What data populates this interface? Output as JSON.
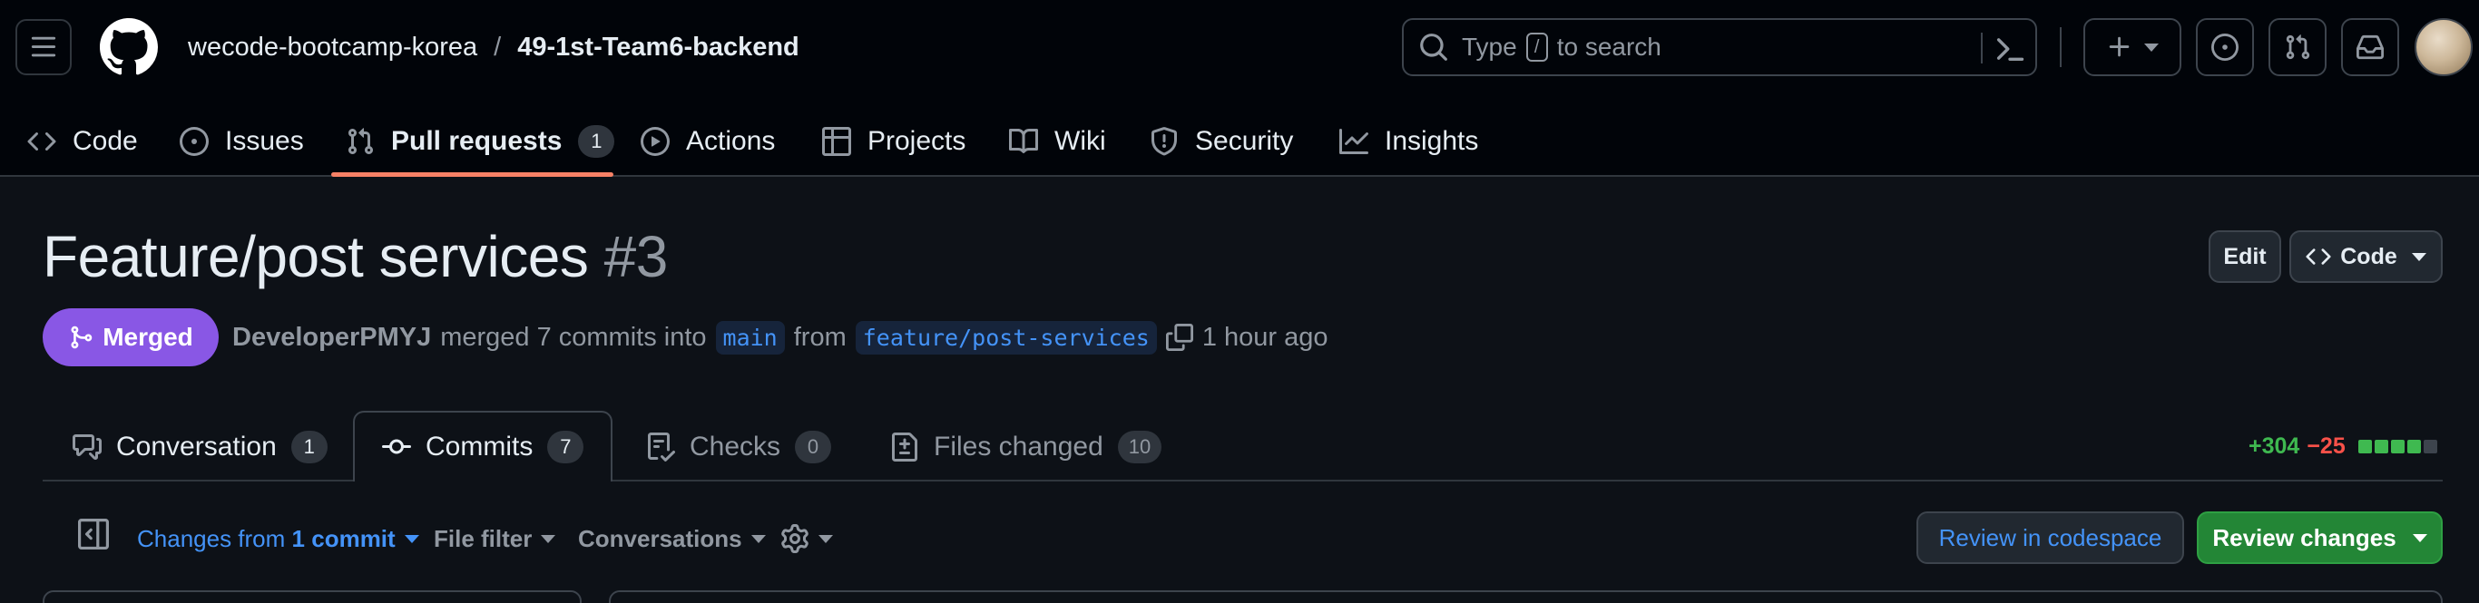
{
  "header": {
    "repo_owner": "wecode-bootcamp-korea",
    "repo_separator": "/",
    "repo_name": "49-1st-Team6-backend",
    "search": {
      "before": "Type",
      "key": "/",
      "after": "to search"
    }
  },
  "repo_nav": [
    {
      "label": "Code",
      "icon": "code-icon"
    },
    {
      "label": "Issues",
      "icon": "issue-icon"
    },
    {
      "label": "Pull requests",
      "icon": "pull-request-icon",
      "count": "1",
      "active": true
    },
    {
      "label": "Actions",
      "icon": "play-icon"
    },
    {
      "label": "Projects",
      "icon": "table-icon"
    },
    {
      "label": "Wiki",
      "icon": "book-icon"
    },
    {
      "label": "Security",
      "icon": "shield-icon"
    },
    {
      "label": "Insights",
      "icon": "graph-icon"
    }
  ],
  "pr": {
    "title": "Feature/post services",
    "number": "#3",
    "state": "Merged",
    "author": "DeveloperPMYJ",
    "action_text": "merged 7 commits into",
    "base_branch": "main",
    "from_text": "from",
    "head_branch": "feature/post-services",
    "time": "1 hour ago",
    "edit_label": "Edit",
    "code_label": "Code"
  },
  "tabs": [
    {
      "label": "Conversation",
      "count": "1",
      "icon": "comment-icon"
    },
    {
      "label": "Commits",
      "count": "7",
      "icon": "commit-icon",
      "active": true
    },
    {
      "label": "Checks",
      "count": "0",
      "icon": "checklist-icon"
    },
    {
      "label": "Files changed",
      "count": "10",
      "icon": "file-diff-icon"
    }
  ],
  "diffstat": {
    "additions": "+304",
    "deletions": "−25",
    "block_colors": [
      "#3fb950",
      "#3fb950",
      "#3fb950",
      "#3fb950",
      "#3d444d"
    ]
  },
  "toolbar": {
    "changes_prefix": "Changes from",
    "changes_value": "1 commit",
    "file_filter": "File filter",
    "conversations": "Conversations",
    "review_codespace": "Review in codespace",
    "review_changes": "Review changes"
  },
  "colors": {
    "accent_merged": "#8957e5",
    "link": "#4493f8",
    "primary_button": "#238636",
    "nav_underline": "#f78166"
  }
}
